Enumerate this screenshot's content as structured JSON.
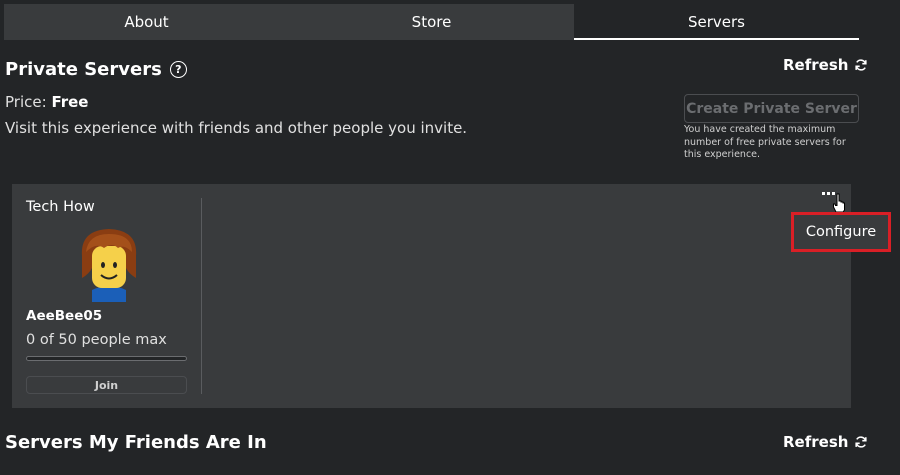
{
  "tabs": [
    {
      "label": "About"
    },
    {
      "label": "Store"
    },
    {
      "label": "Servers"
    }
  ],
  "private_servers": {
    "title": "Private Servers",
    "help_icon": "question-circle-icon",
    "refresh_label": "Refresh",
    "price_label": "Price:",
    "price_value": "Free",
    "description": "Visit this experience with friends and other people you invite.",
    "create_button": "Create Private Server",
    "limit_note": "You have created the maximum number of free private servers for this experience."
  },
  "server_card": {
    "name": "Tech How",
    "owner": "AeeBee05",
    "capacity": "0 of 50 people max",
    "fill_fraction": 0,
    "join_label": "Join",
    "configure_label": "Configure",
    "highlight_color": "#d91f26"
  },
  "friends_servers": {
    "title": "Servers My Friends Are In",
    "refresh_label": "Refresh"
  }
}
